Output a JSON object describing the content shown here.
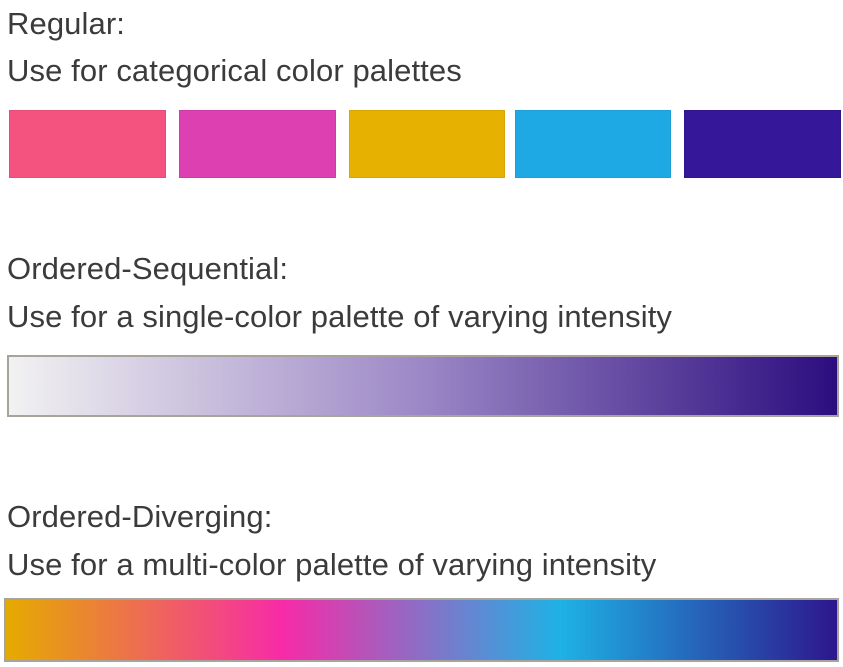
{
  "regular": {
    "heading": "Regular:",
    "description": "Use for categorical color palettes",
    "colors": [
      "#f4527f",
      "#dc40b1",
      "#e6b100",
      "#1ea8e4",
      "#35179a"
    ]
  },
  "sequential": {
    "heading": "Ordered-Sequential:",
    "description": "Use for a single-color palette of varying intensity",
    "gradient": [
      "#f2f2f2",
      "#9c87c6",
      "#2c0d7e"
    ]
  },
  "diverging": {
    "heading": "Ordered-Diverging:",
    "description": "Use for a multi-color palette of varying intensity",
    "gradient": [
      "#e5ab00",
      "#f72ba7",
      "#1eb2e5",
      "#2d168d"
    ]
  }
}
